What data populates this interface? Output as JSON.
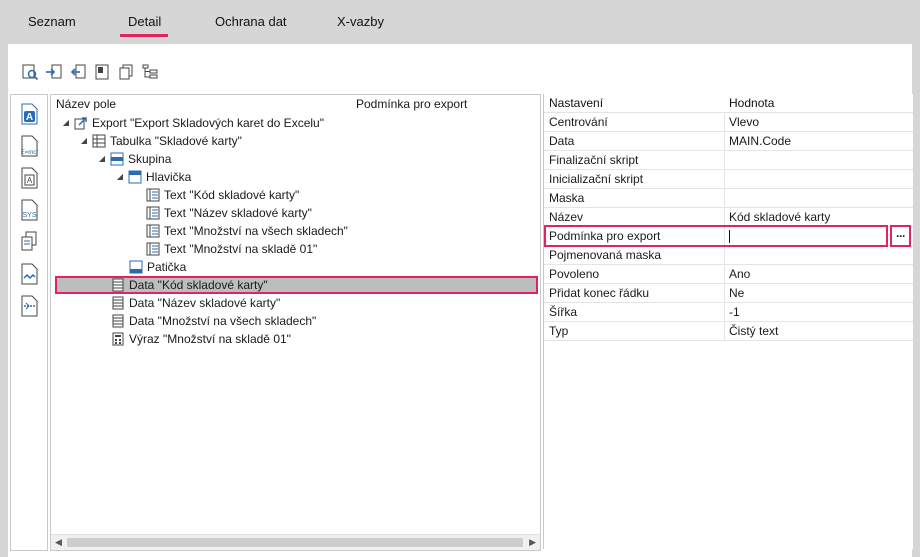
{
  "tabs": [
    {
      "label": "Seznam"
    },
    {
      "label": "Detail"
    },
    {
      "label": "Ochrana dat"
    },
    {
      "label": "X-vazby"
    }
  ],
  "active_tab": "Detail",
  "toolbar": {
    "icons": [
      "preview-icon",
      "import-icon",
      "export-icon",
      "page-icon",
      "copy-icon",
      "tree-structure-icon"
    ]
  },
  "side_toolbar": {
    "icons": [
      "field-a-icon",
      "expression-icon",
      "text-field-icon",
      "system-variable-icon",
      "copy-field-icon",
      "link-icon",
      "page-break-icon"
    ]
  },
  "tree": {
    "col_name": "Název pole",
    "col_condition": "Podmínka pro export",
    "nodes": [
      {
        "label": "Export \"Export Skladových karet do Excelu\"",
        "icon": "export-icon",
        "expand": "◢",
        "level": 0
      },
      {
        "label": "Tabulka \"Skladové karty\"",
        "icon": "table-icon",
        "expand": "◢",
        "level": 1
      },
      {
        "label": "Skupina",
        "icon": "group-icon",
        "expand": "◢",
        "level": 2
      },
      {
        "label": "Hlavička",
        "icon": "header-icon",
        "expand": "◢",
        "level": 3
      },
      {
        "label": "Text \"Kód skladové karty\"",
        "icon": "text-icon",
        "expand": "",
        "level": 4
      },
      {
        "label": "Text \"Název skladové karty\"",
        "icon": "text-icon",
        "expand": "",
        "level": 4
      },
      {
        "label": "Text \"Množství na všech skladech\"",
        "icon": "text-icon",
        "expand": "",
        "level": 4
      },
      {
        "label": "Text \"Množství na skladě 01\"",
        "icon": "text-icon",
        "expand": "",
        "level": 4
      },
      {
        "label": "Patička",
        "icon": "footer-icon",
        "expand": "",
        "level": 3
      },
      {
        "label": "Data \"Kód skladové karty\"",
        "icon": "data-icon",
        "expand": "",
        "level": 2,
        "selected": true
      },
      {
        "label": "Data \"Název skladové karty\"",
        "icon": "data-icon",
        "expand": "",
        "level": 2
      },
      {
        "label": "Data \"Množství na všech skladech\"",
        "icon": "data-icon",
        "expand": "",
        "level": 2
      },
      {
        "label": "Výraz \"Množství na skladě 01\"",
        "icon": "calculator-icon",
        "expand": "",
        "level": 2
      }
    ]
  },
  "properties": {
    "col_setting": "Nastavení",
    "col_value": "Hodnota",
    "rows": [
      {
        "name": "Centrování",
        "value": "Vlevo"
      },
      {
        "name": "Data",
        "value": "MAIN.Code"
      },
      {
        "name": "Finalizační skript",
        "value": ""
      },
      {
        "name": "Inicializační skript",
        "value": ""
      },
      {
        "name": "Maska",
        "value": ""
      },
      {
        "name": "Název",
        "value": "Kód skladové karty"
      },
      {
        "name": "Podmínka pro export",
        "value": "",
        "editing": true
      },
      {
        "name": "Pojmenovaná maska",
        "value": ""
      },
      {
        "name": "Povoleno",
        "value": "Ano"
      },
      {
        "name": "Přidat konec řádku",
        "value": "Ne"
      },
      {
        "name": "Šířka",
        "value": "-1"
      },
      {
        "name": "Typ",
        "value": "Čistý text"
      }
    ],
    "ellipsis_label": "···"
  },
  "colors": {
    "highlight": "#e0245e",
    "selection": "#bdbdbd",
    "background": "#d6d6d6",
    "icon_blue": "#2b6cb0"
  }
}
